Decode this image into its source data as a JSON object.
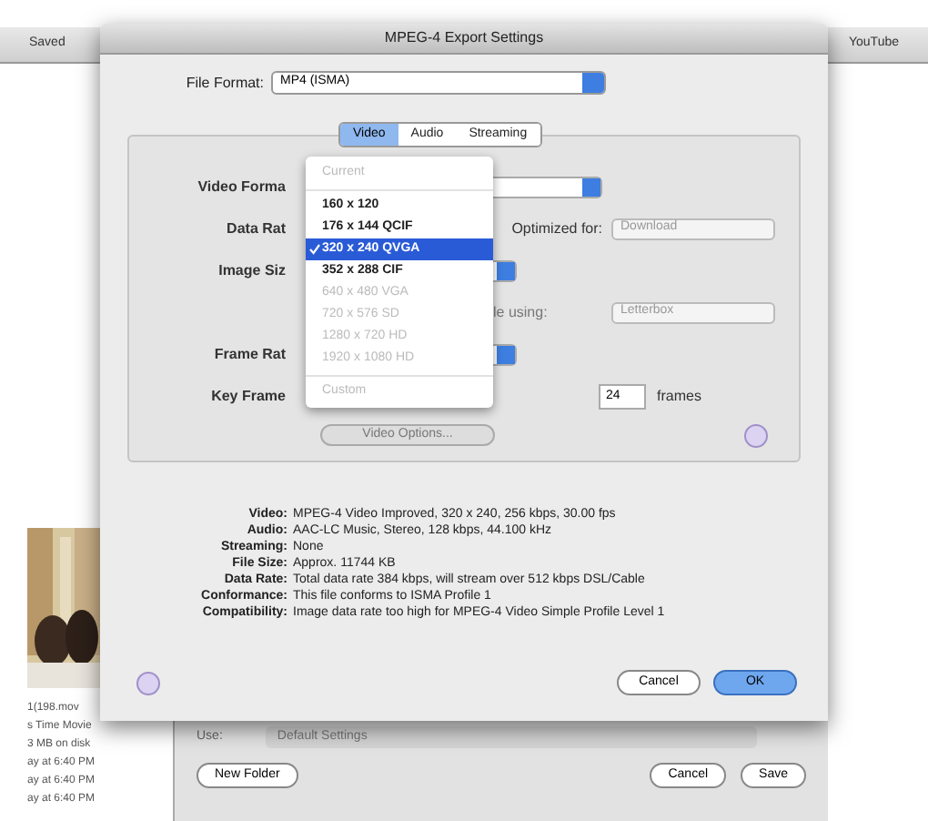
{
  "background_window": {
    "toolbar_left": "Saved",
    "toolbar_right": "YouTube",
    "file_info": [
      "1(198.mov",
      "s Time Movie",
      "3 MB on disk",
      "ay at 6:40 PM",
      "ay at 6:40 PM",
      "ay at 6:40 PM"
    ],
    "use_label": "Use:",
    "use_value": "Default Settings",
    "buttons": [
      {
        "label": "New Folder",
        "kind": "left"
      },
      {
        "label": "Cancel",
        "kind": "right"
      },
      {
        "label": "Save",
        "kind": "right"
      }
    ]
  },
  "dialog": {
    "title": "MPEG-4 Export Settings",
    "file_format": {
      "label": "File Format:",
      "value": "MP4 (ISMA)"
    },
    "tabs": [
      {
        "label": "Video",
        "selected": true
      },
      {
        "label": "Audio",
        "selected": false
      },
      {
        "label": "Streaming",
        "selected": false
      }
    ],
    "settings": {
      "video_format": {
        "label": "Video Forma"
      },
      "data_rate": {
        "label": "Data Rat"
      },
      "optimized_for": {
        "label": "Optimized for:",
        "value": "Download"
      },
      "image_size": {
        "label": "Image Siz"
      },
      "scale": {
        "label": "le using:",
        "value": "Letterbox"
      },
      "frame_rate": {
        "label": "Frame Rat"
      },
      "key_frame": {
        "label": "Key Frame",
        "value": "24",
        "unit": "frames"
      },
      "video_options": "Video Options..."
    },
    "menu": {
      "items": [
        {
          "label": "Current",
          "selected": false,
          "disabled": true,
          "separator_after": true
        },
        {
          "label": "160 x 120",
          "selected": false,
          "disabled": false
        },
        {
          "label": "176 x 144 QCIF",
          "selected": false,
          "disabled": false
        },
        {
          "label": "320 x 240 QVGA",
          "selected": true,
          "disabled": false
        },
        {
          "label": "352 x 288 CIF",
          "selected": false,
          "disabled": false
        },
        {
          "label": "640 x 480 VGA",
          "selected": false,
          "disabled": true
        },
        {
          "label": "720 x 576 SD",
          "selected": false,
          "disabled": true
        },
        {
          "label": "1280 x 720 HD",
          "selected": false,
          "disabled": true
        },
        {
          "label": "1920 x 1080 HD",
          "selected": false,
          "disabled": true,
          "separator_after": true
        },
        {
          "label": "Custom",
          "selected": false,
          "disabled": true
        }
      ]
    },
    "summary": [
      {
        "label": "Video:",
        "value": "MPEG-4 Video Improved, 320 x 240, 256 kbps, 30.00 fps"
      },
      {
        "label": "Audio:",
        "value": "AAC-LC Music, Stereo, 128 kbps, 44.100 kHz"
      },
      {
        "label": "Streaming:",
        "value": "None"
      },
      {
        "label": "File Size:",
        "value": "Approx. 11744 KB"
      },
      {
        "label": "Data Rate:",
        "value": "Total data rate 384 kbps, will stream over 512 kbps DSL/Cable"
      },
      {
        "label": "Conformance:",
        "value": "This file conforms to ISMA Profile 1"
      },
      {
        "label": "Compatibility:",
        "value": "Image data rate too high for MPEG-4 Video Simple Profile Level 1"
      }
    ],
    "buttons": [
      {
        "label": "Cancel",
        "default": false
      },
      {
        "label": "OK",
        "default": true
      }
    ]
  }
}
